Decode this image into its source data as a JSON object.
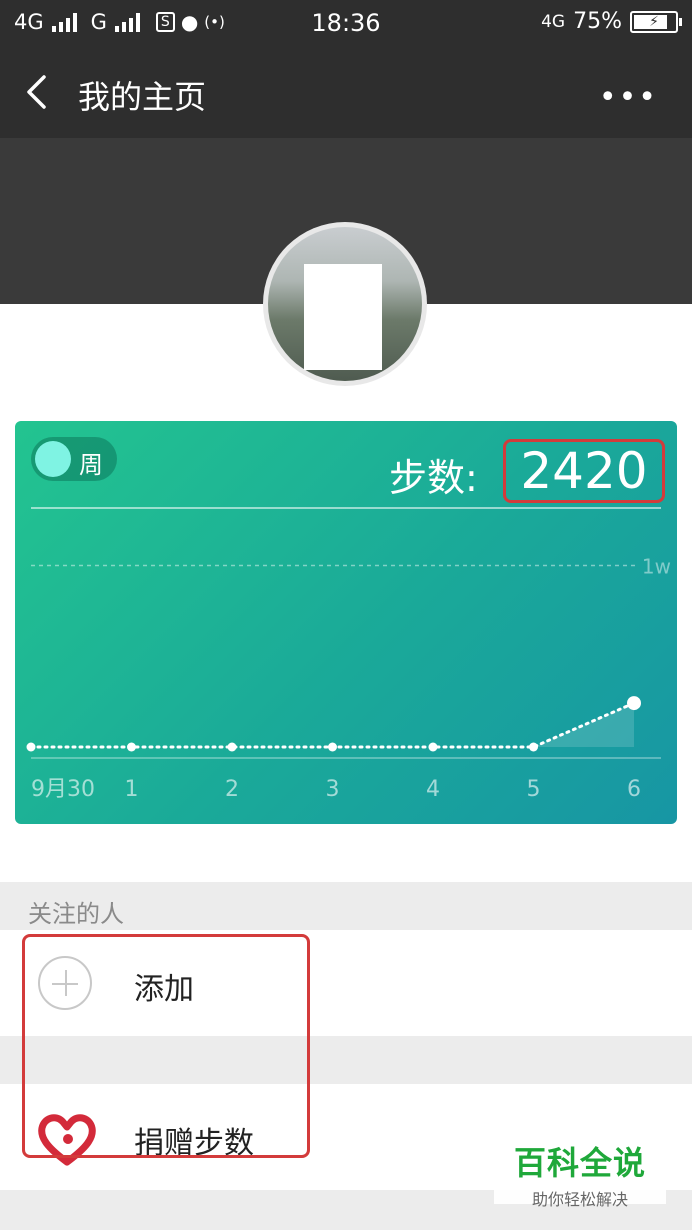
{
  "status_bar": {
    "left": [
      "4G",
      "G"
    ],
    "time": "18:36",
    "network": "4G",
    "battery": "75%"
  },
  "navbar": {
    "title": "我的主页",
    "more_label": "•••"
  },
  "step_card": {
    "toggle_label": "周",
    "steps_label": "步数:",
    "steps_value": "2420"
  },
  "chart_data": {
    "type": "line",
    "categories": [
      "9月30",
      "1",
      "2",
      "3",
      "4",
      "5",
      "6"
    ],
    "values": [
      0,
      0,
      0,
      0,
      0,
      0,
      2420
    ],
    "reference_line": {
      "label": "1w",
      "value": 10000
    },
    "ylim": [
      0,
      13000
    ]
  },
  "following": {
    "section_title": "关注的人",
    "add_label": "添加",
    "donate_label": "捐赠步数"
  },
  "watermark": {
    "title": "百科全说",
    "subtitle": "助你轻松解决"
  },
  "colors": {
    "card_gradient_start": "#23c490",
    "card_gradient_end": "#1796a4",
    "highlight": "#d33b3b",
    "watermark_green": "#1fa83a"
  }
}
